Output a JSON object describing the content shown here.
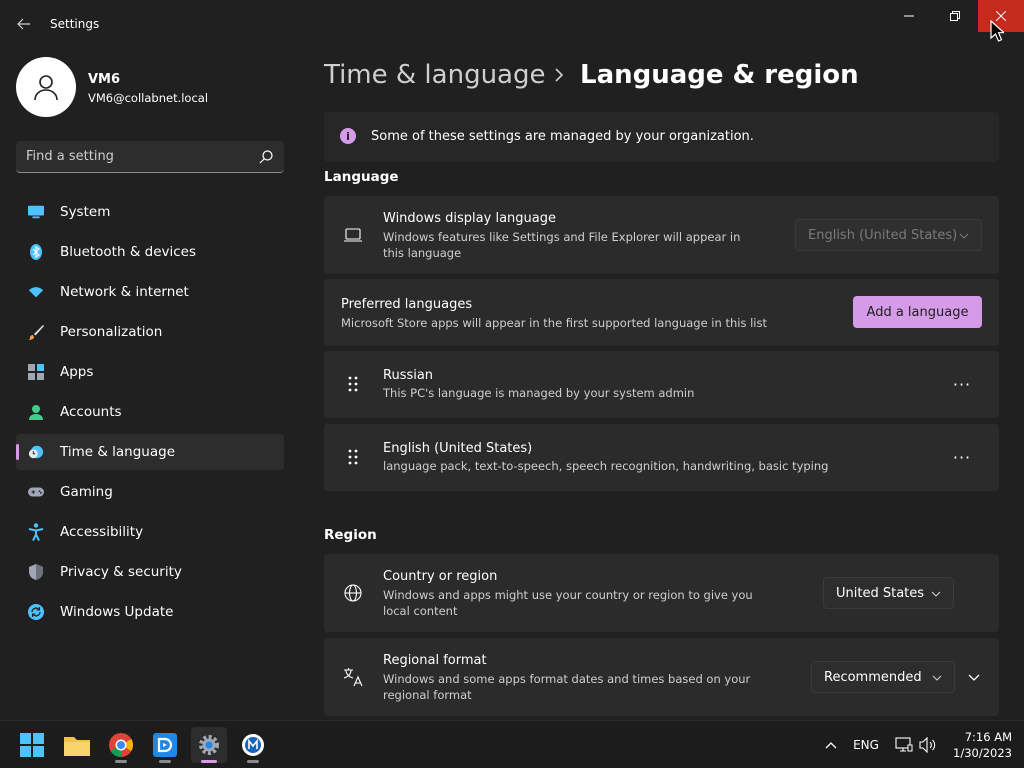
{
  "window": {
    "title": "Settings"
  },
  "user": {
    "name": "VM6",
    "email": "VM6@collabnet.local"
  },
  "search": {
    "placeholder": "Find a setting"
  },
  "sidebar": {
    "items": [
      {
        "label": "System",
        "icon": "system-icon"
      },
      {
        "label": "Bluetooth & devices",
        "icon": "bluetooth-icon"
      },
      {
        "label": "Network & internet",
        "icon": "wifi-icon"
      },
      {
        "label": "Personalization",
        "icon": "brush-icon"
      },
      {
        "label": "Apps",
        "icon": "apps-icon"
      },
      {
        "label": "Accounts",
        "icon": "person-icon"
      },
      {
        "label": "Time & language",
        "icon": "clock-globe-icon",
        "active": true
      },
      {
        "label": "Gaming",
        "icon": "gamepad-icon"
      },
      {
        "label": "Accessibility",
        "icon": "accessibility-icon"
      },
      {
        "label": "Privacy & security",
        "icon": "shield-icon"
      },
      {
        "label": "Windows Update",
        "icon": "update-icon"
      }
    ]
  },
  "breadcrumb": {
    "parent": "Time & language",
    "current": "Language & region"
  },
  "banner": {
    "text": "Some of these settings are managed by your organization."
  },
  "language": {
    "section_title": "Language",
    "display_language": {
      "title": "Windows display language",
      "description": "Windows features like Settings and File Explorer will appear in this language",
      "value": "English (United States)"
    },
    "preferred": {
      "title": "Preferred languages",
      "description": "Microsoft Store apps will appear in the first supported language in this list",
      "button_label": "Add a language"
    },
    "languages": [
      {
        "name": "Russian",
        "description": "This PC's language is managed by your system admin"
      },
      {
        "name": "English (United States)",
        "description": "language pack, text-to-speech, speech recognition, handwriting, basic typing"
      }
    ],
    "more_glyph": "···"
  },
  "region": {
    "section_title": "Region",
    "country": {
      "title": "Country or region",
      "description": "Windows and apps might use your country or region to give you local content",
      "value": "United States"
    },
    "format": {
      "title": "Regional format",
      "description": "Windows and some apps format dates and times based on your regional format",
      "value": "Recommended"
    }
  },
  "taskbar": {
    "input_language": "ENG",
    "time": "7:16 AM",
    "date": "1/30/2023"
  },
  "colors": {
    "accent": "#d59be8",
    "background": "#202020",
    "card": "#2b2b2b",
    "close_hover": "#c42b1c"
  }
}
